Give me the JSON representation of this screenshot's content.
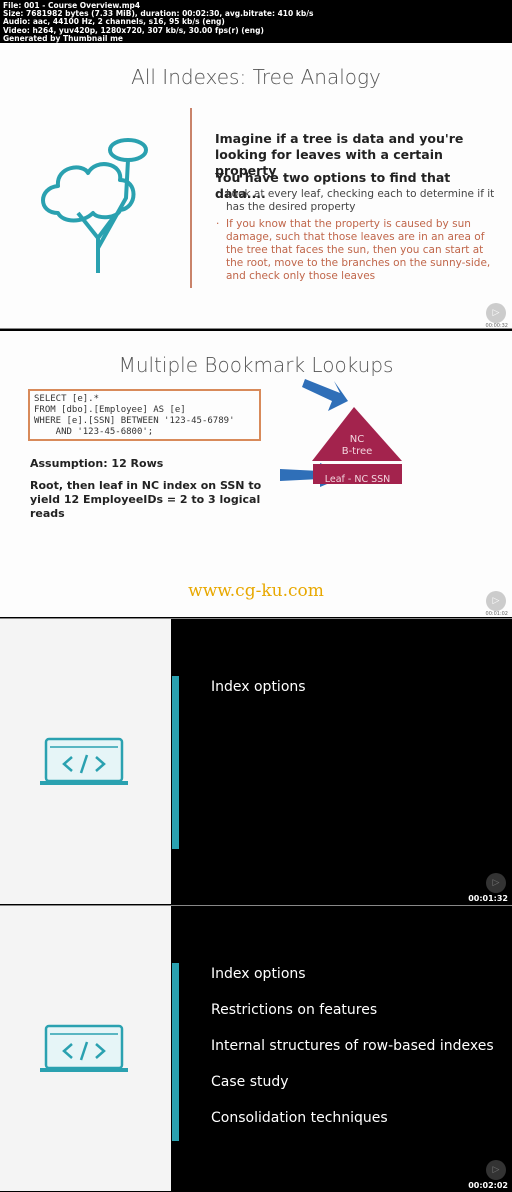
{
  "header": {
    "lines": [
      "File: 001 - Course Overview.mp4",
      "Size: 7681982 bytes (7.33 MiB), duration: 00:02:30, avg.bitrate: 410 kb/s",
      "Audio: aac, 44100 Hz, 2 channels, s16, 95 kb/s (eng)",
      "Video: h264, yuv420p, 1280x720, 307 kb/s, 30.00 fps(r) (eng)",
      "Generated by Thumbnail me"
    ]
  },
  "frames": [
    {
      "title": "All Indexes: Tree Analogy",
      "heading1": "Imagine if a tree is data and you're looking for leaves with a certain property",
      "heading2": "You have two options to find that data....",
      "bullets": [
        "Look at every leaf, checking each to determine if it has the desired property",
        "If you know that the property is caused by sun damage, such that those leaves are in an area of the tree that faces the sun, then you can start at the root, move to the branches on the sunny-side, and check only those leaves"
      ],
      "timestamp": "00:00:32",
      "accent": "#2aa1b0",
      "highlight": "#c0664a"
    },
    {
      "title": "Multiple Bookmark Lookups",
      "code": "SELECT [e].*\nFROM [dbo].[Employee] AS [e]\nWHERE [e].[SSN] BETWEEN '123-45-6789'\n    AND '123-45-6800';",
      "assumption": "Assumption: 12 Rows",
      "explanation": "Root, then leaf in NC index on SSN to yield 12 EmployeeIDs = 2 to 3 logical reads",
      "tree_label": "NC B-tree",
      "tree_label_1": "NC",
      "tree_label_2": "B-tree",
      "leaf_label": "Leaf - NC SSN",
      "watermark": "www.cg-ku.com",
      "timestamp": "00:01:02",
      "tree_color": "#a3234d",
      "arrow_color": "#2f6fb8"
    },
    {
      "items": [
        "Index options"
      ],
      "timestamp": "00:01:32"
    },
    {
      "items": [
        "Index options",
        "Restrictions on features",
        "Internal structures of row-based indexes",
        "Case study",
        "Consolidation techniques"
      ],
      "timestamp": "00:02:02"
    }
  ]
}
